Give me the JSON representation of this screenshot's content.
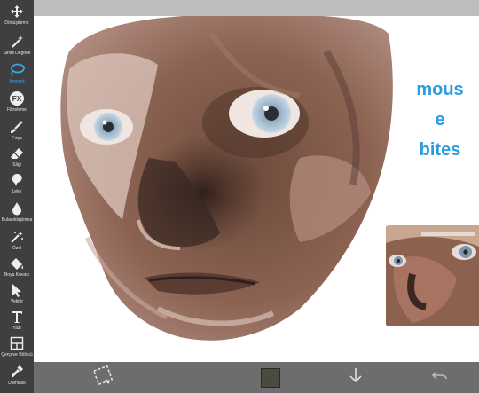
{
  "toolbar": {
    "tools": [
      {
        "label": "Dönüştürme",
        "icon": "move-arrows-icon"
      },
      {
        "label": "Sihirli Değnek",
        "icon": "magic-wand-icon"
      },
      {
        "label": "Kement",
        "icon": "lasso-icon"
      },
      {
        "label": "Filtreleme",
        "icon": "fx-icon"
      },
      {
        "label": "Fırça",
        "icon": "brush-icon"
      },
      {
        "label": "Silgi",
        "icon": "eraser-icon"
      },
      {
        "label": "Leke",
        "icon": "smudge-icon"
      },
      {
        "label": "Bulanıklaştırma",
        "icon": "blur-drop-icon"
      },
      {
        "label": "Özel",
        "icon": "special-wand-icon"
      },
      {
        "label": "Boya Kovası",
        "icon": "paint-bucket-icon"
      },
      {
        "label": "Vektör",
        "icon": "vector-cursor-icon"
      },
      {
        "label": "Yazı",
        "icon": "text-icon"
      },
      {
        "label": "Çerçeve Bölücü",
        "icon": "frame-divider-icon"
      },
      {
        "label": "Damlalık",
        "icon": "eyedropper-icon"
      }
    ],
    "active_index": 2
  },
  "canvas": {
    "annotation": [
      "mous",
      "e",
      "bites"
    ],
    "annotation_color": "#2c9be0"
  },
  "bottom_bar": {
    "current_color": "#4b4a3f"
  }
}
